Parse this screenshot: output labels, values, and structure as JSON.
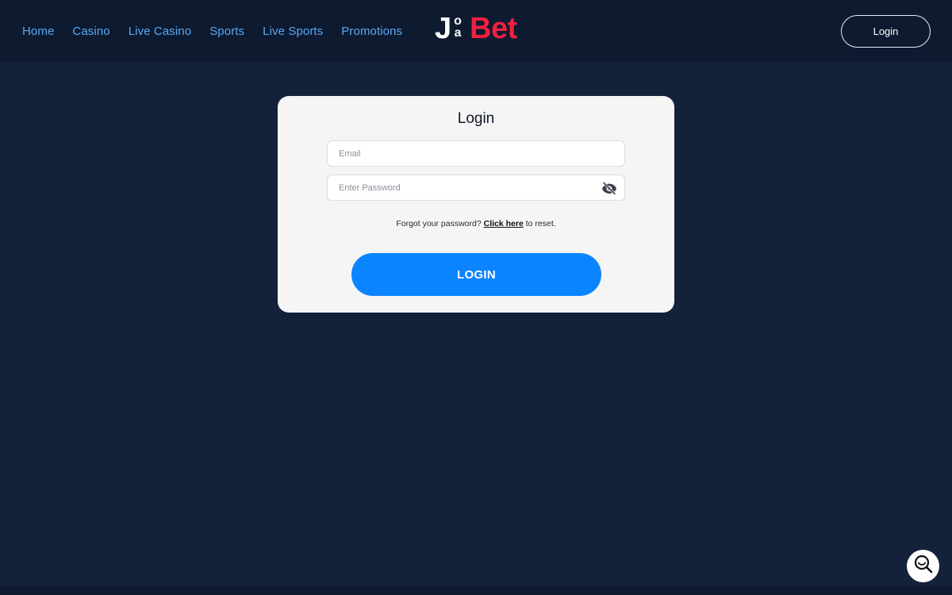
{
  "nav": {
    "items": [
      {
        "label": "Home"
      },
      {
        "label": "Casino"
      },
      {
        "label": "Live Casino"
      },
      {
        "label": "Sports"
      },
      {
        "label": "Live Sports"
      },
      {
        "label": "Promotions"
      }
    ]
  },
  "logo": {
    "j": "J",
    "oa_top": "o",
    "oa_bottom": "a",
    "bet": "Bet"
  },
  "header": {
    "login_label": "Login"
  },
  "login_card": {
    "title": "Login",
    "email": {
      "placeholder": "Email",
      "value": ""
    },
    "password": {
      "placeholder": "Enter Password",
      "value": ""
    },
    "forgot_prefix": "Forgot your password?",
    "forgot_link": "Click here",
    "forgot_suffix": "to reset.",
    "submit_label": "LOGIN"
  },
  "icons": {
    "password_toggle": "eye-slash-icon",
    "support": "search-chat-icon"
  },
  "colors": {
    "background": "#13213a",
    "topbar": "#0d1a30",
    "nav_link": "#5aa9f2",
    "brand_red": "#f0203e",
    "primary_button": "#0a84ff",
    "card": "#f5f5f5"
  }
}
